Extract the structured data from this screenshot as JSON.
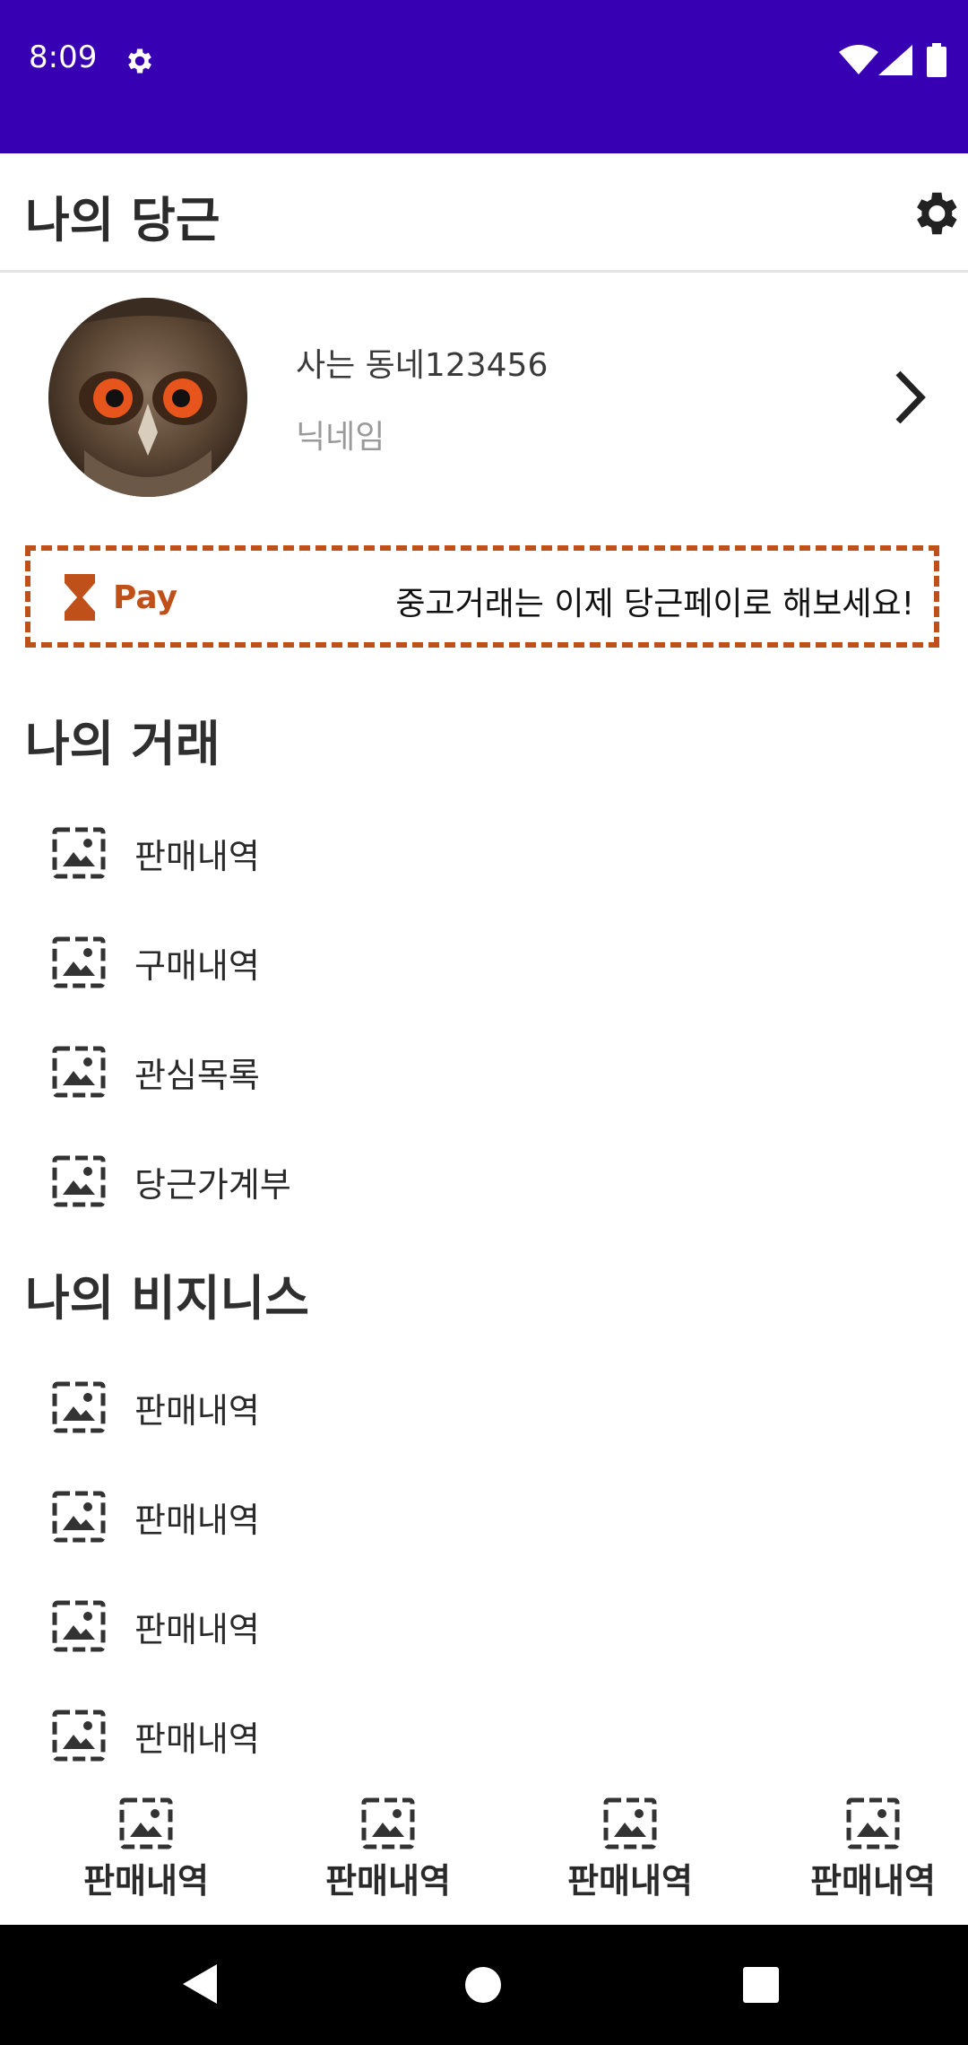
{
  "status_bar": {
    "time": "8:09",
    "icons": [
      "gear-icon",
      "wifi-icon",
      "signal-icon",
      "battery-icon"
    ],
    "background": "#3700B3"
  },
  "app_bar": {
    "title": "나의 당근",
    "action_icon": "settings-icon"
  },
  "profile": {
    "name": "사는 동네123456",
    "nickname": "닉네임",
    "avatar": "owl-avatar-photo",
    "action_icon": "chevron-right-icon"
  },
  "pay_banner": {
    "label": "Pay",
    "message": "중고거래는 이제 당근페이로 해보세요!",
    "accent": "#C0501A"
  },
  "sections": [
    {
      "title": "나의 거래",
      "items": [
        {
          "label": "판매내역"
        },
        {
          "label": "구매내역"
        },
        {
          "label": "관심목록"
        },
        {
          "label": "당근가계부"
        }
      ]
    },
    {
      "title": "나의 비지니스",
      "items": [
        {
          "label": "판매내역"
        },
        {
          "label": "판매내역"
        },
        {
          "label": "판매내역"
        },
        {
          "label": "판매내역"
        }
      ]
    }
  ],
  "bottom_nav": [
    {
      "label": "판매내역"
    },
    {
      "label": "판매내역"
    },
    {
      "label": "판매내역"
    },
    {
      "label": "판매내역"
    }
  ],
  "system_nav": {
    "icons": [
      "back-icon",
      "home-icon",
      "recents-icon"
    ]
  }
}
